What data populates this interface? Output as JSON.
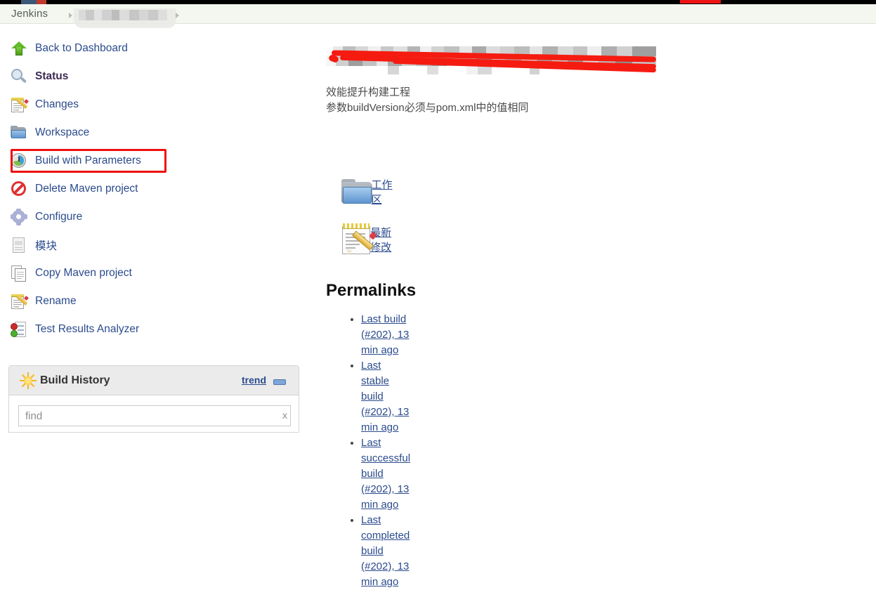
{
  "browser": {
    "tab_strip_present": true,
    "accent_red": "#ee1414"
  },
  "breadcrumb": {
    "root_label": "Jenkins",
    "redacted_item_label": "",
    "separator_glyph": "▸"
  },
  "sidebar": {
    "items": [
      {
        "label": "Back to Dashboard",
        "icon": "up-arrow-icon",
        "active": false
      },
      {
        "label": "Status",
        "icon": "search-icon",
        "active": true
      },
      {
        "label": "Changes",
        "icon": "notepad-pencil-icon",
        "active": false
      },
      {
        "label": "Workspace",
        "icon": "folder-icon",
        "active": false
      },
      {
        "label": "Build with Parameters",
        "icon": "build-clock-icon",
        "active": false,
        "highlighted": true
      },
      {
        "label": "Delete Maven project",
        "icon": "delete-icon",
        "active": false
      },
      {
        "label": "Configure",
        "icon": "gear-icon",
        "active": false
      },
      {
        "label": "模块",
        "icon": "document-icon",
        "active": false
      },
      {
        "label": "Copy Maven project",
        "icon": "copy-icon",
        "active": false
      },
      {
        "label": "Rename",
        "icon": "notepad-pencil-icon",
        "active": false
      },
      {
        "label": "Test Results Analyzer",
        "icon": "test-results-icon",
        "active": false
      }
    ],
    "highlight_color": "#ee1111",
    "link_color": "#2b4b8d",
    "active_color": "#3c2a55"
  },
  "build_history": {
    "title": "Build History",
    "icon": "sun-icon",
    "trend_label": "trend",
    "collapse_icon": "collapse-bar-icon",
    "find": {
      "placeholder": "find",
      "value": "",
      "clear_label": "x"
    }
  },
  "main": {
    "job_title_redacted": true,
    "redaction_scribble_color": "#f51b10",
    "description_lines": [
      "效能提升构建工程",
      "参数buildVersion必须与pom.xml中的值相同"
    ],
    "content_links": [
      {
        "label": "工作区",
        "icon": "big-folder-icon"
      },
      {
        "label": "最新修改",
        "icon": "big-notepad-icon"
      }
    ],
    "permalinks": {
      "heading": "Permalinks",
      "items": [
        "Last build (#202), 13 min ago",
        "Last stable build (#202), 13 min ago",
        "Last successful build (#202), 13 min ago",
        "Last completed build (#202), 13 min ago"
      ]
    }
  }
}
